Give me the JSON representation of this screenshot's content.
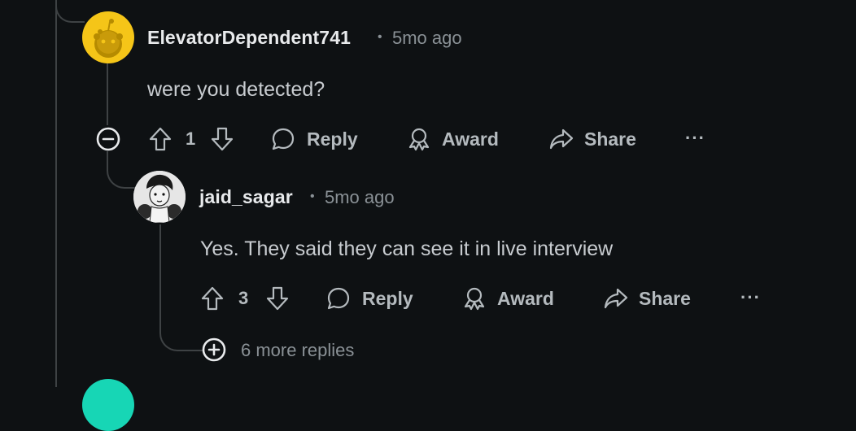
{
  "comments": [
    {
      "username": "ElevatorDependent741",
      "time": "5mo ago",
      "text": "were you detected?",
      "votes": "1",
      "actions": {
        "reply": "Reply",
        "award": "Award",
        "share": "Share",
        "more": "···"
      }
    },
    {
      "username": "jaid_sagar",
      "time": "5mo ago",
      "text": "Yes. They said they can see it in live interview",
      "votes": "3",
      "actions": {
        "reply": "Reply",
        "award": "Award",
        "share": "Share",
        "more": "···"
      }
    }
  ],
  "separator": "•",
  "more_replies": "6 more replies",
  "colors": {
    "background": "#0e1113",
    "avatar_yellow": "#f5c518",
    "thread_line": "#3e4244",
    "next_avatar": "#17d6b5"
  }
}
